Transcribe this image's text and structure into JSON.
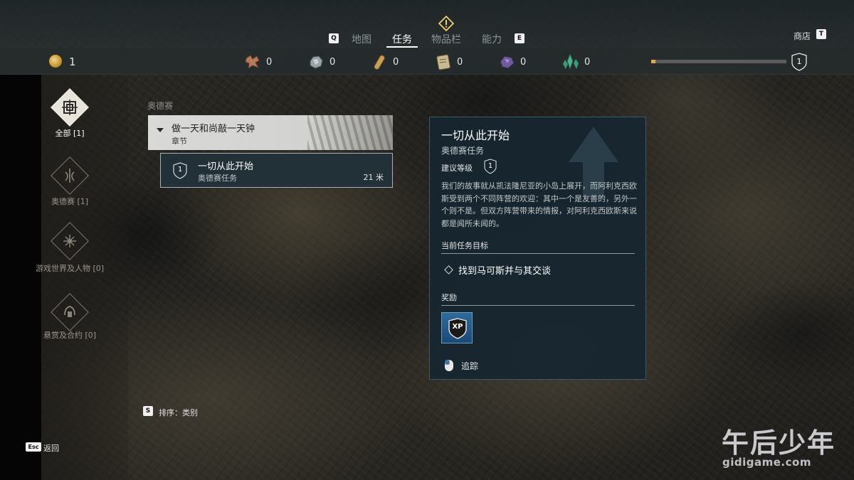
{
  "nav": {
    "left_key": "Q",
    "tabs": [
      "地图",
      "任务",
      "物品栏",
      "能力"
    ],
    "active_tab": 1,
    "right_key": "E",
    "shop_label": "商店",
    "shop_key": "T"
  },
  "resources": {
    "drachmae": "1",
    "items": [
      {
        "icon": "leather-icon",
        "count": "0"
      },
      {
        "icon": "iron-ore-icon",
        "count": "0"
      },
      {
        "icon": "wood-icon",
        "count": "0"
      },
      {
        "icon": "ancient-tablet-icon",
        "count": "0"
      },
      {
        "icon": "obsidian-icon",
        "count": "0"
      },
      {
        "icon": "crystal-icon",
        "count": "0"
      }
    ],
    "xp_progress": 0.03,
    "level": "1"
  },
  "categories": [
    {
      "icon": "all-quests-icon",
      "label": "全部 [1]",
      "active": true
    },
    {
      "icon": "odyssey-icon",
      "label": "奥德赛 [1]",
      "active": false
    },
    {
      "icon": "world-people-icon",
      "label": "游戏世界及人物 [0]",
      "active": false
    },
    {
      "icon": "bounty-contract-icon",
      "label": "悬赏及合约 [0]",
      "active": false
    }
  ],
  "quest_list": {
    "region": "奥德赛",
    "chapter_title": "做一天和尚敲一天钟",
    "chapter_sub": "章节",
    "quest": {
      "level": "1",
      "title": "一切从此开始",
      "type": "奥德赛任务",
      "distance": "21 米"
    }
  },
  "sort": {
    "key": "S",
    "label": "排序：类别"
  },
  "back": {
    "key": "Esc",
    "label": "返回"
  },
  "details": {
    "title": "一切从此开始",
    "subtitle": "奥德赛任务",
    "level_label": "建议等级",
    "level": "1",
    "description": "我们的故事就从凯法隆尼亚的小岛上展开，而阿利克西欧斯受到两个不同阵营的欢迎：其中一个是友善的，另外一个则不是。但双方阵营带来的情报，对阿利克西欧斯来说都是闻所未闻的。",
    "objective_header": "当前任务目标",
    "objective": "找到马可斯并与其交谈",
    "reward_header": "奖励",
    "reward_badge": "XP",
    "track_label": "追踪"
  },
  "watermark": {
    "title": "午后少年",
    "url": "gidigame.com"
  },
  "colors": {
    "accent": "#ffffff",
    "panel": "#162630",
    "xp_fill": "#e0a85a",
    "quest_card": "#223038"
  }
}
